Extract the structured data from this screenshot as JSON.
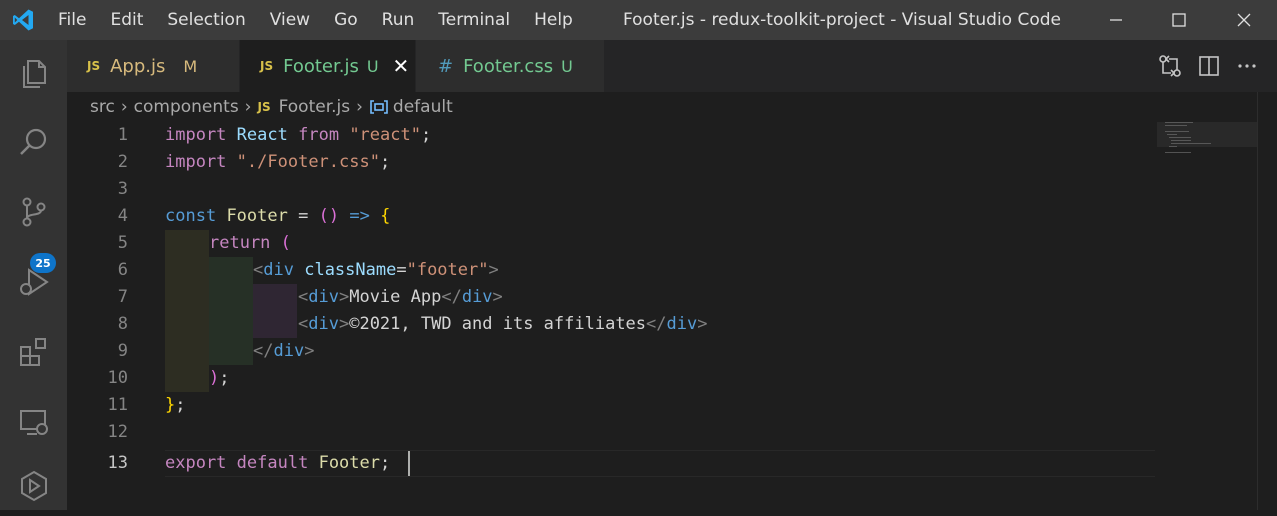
{
  "app": {
    "title": "Footer.js - redux-toolkit-project - Visual Studio Code"
  },
  "menu": [
    "File",
    "Edit",
    "Selection",
    "View",
    "Go",
    "Run",
    "Terminal",
    "Help"
  ],
  "activity": {
    "scm_badge": "25"
  },
  "tabs": [
    {
      "icon": "JS",
      "label": "App.js",
      "status": "M",
      "label_color": "#d7ba7d",
      "status_color": "#d7ba7d"
    },
    {
      "icon": "JS",
      "label": "Footer.js",
      "status": "U",
      "label_color": "#73c991",
      "status_color": "#73c991",
      "active": true
    },
    {
      "icon": "#",
      "label": "Footer.css",
      "status": "U",
      "label_color": "#73c991",
      "status_color": "#73c991"
    }
  ],
  "breadcrumb": {
    "items": [
      "src",
      "components",
      "Footer.js",
      "default"
    ],
    "file_icon": "JS"
  },
  "editor": {
    "line_numbers": [
      "1",
      "2",
      "3",
      "4",
      "5",
      "6",
      "7",
      "8",
      "9",
      "10",
      "11",
      "12",
      "13"
    ],
    "active_line": "13",
    "tokens": {
      "l1": [
        "import",
        "React",
        "from",
        "\"react\"",
        ";"
      ],
      "l2": [
        "import",
        "\"./Footer.css\"",
        ";"
      ],
      "l4": [
        "const",
        "Footer",
        "=",
        "()",
        "=>",
        "{"
      ],
      "l5": [
        "return",
        "("
      ],
      "l6": [
        "<",
        "div",
        "className",
        "=",
        "\"footer\"",
        ">"
      ],
      "l7": [
        "<",
        "div",
        ">",
        "Movie App",
        "</",
        "div",
        ">"
      ],
      "l8": [
        "<",
        "div",
        ">",
        "©2021, TWD and its affiliates",
        "</",
        "div",
        ">"
      ],
      "l9": [
        "</",
        "div",
        ">"
      ],
      "l10": [
        ")",
        ";"
      ],
      "l11": [
        "}",
        ";"
      ],
      "l13": [
        "export",
        "default",
        "Footer",
        ";"
      ]
    }
  },
  "colors": {
    "accent": "#007acc",
    "background": "#1e1e1e",
    "titlebar": "#3c3c3c",
    "activitybar": "#333333"
  }
}
